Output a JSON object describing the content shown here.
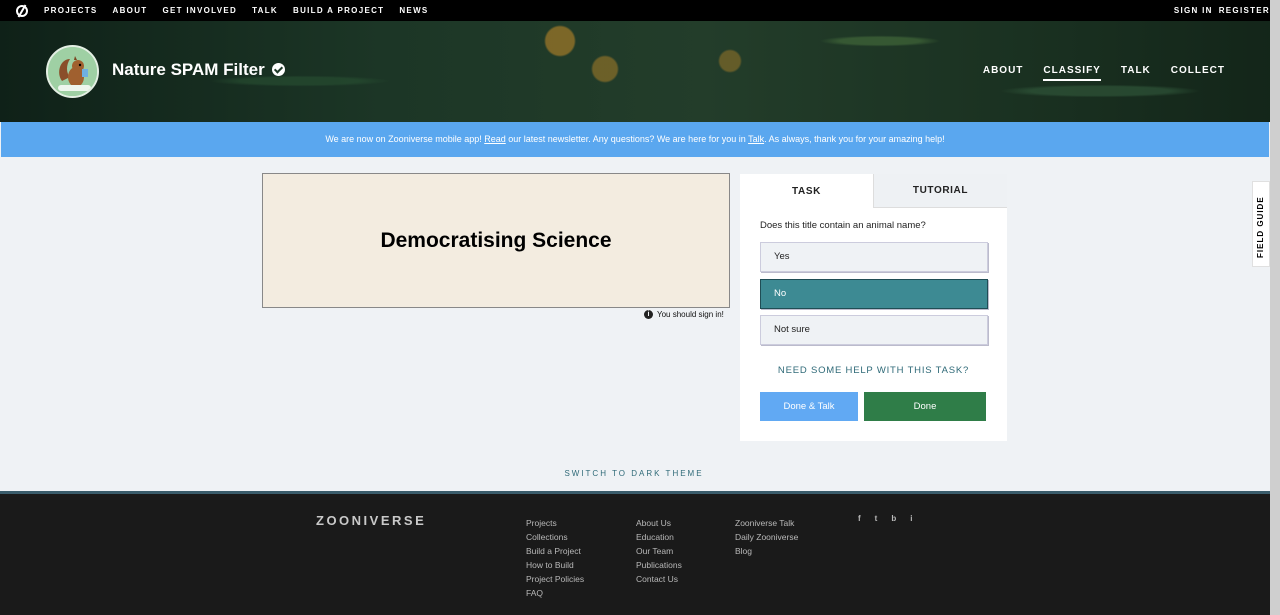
{
  "topbar": {
    "nav": [
      "PROJECTS",
      "ABOUT",
      "GET INVOLVED",
      "TALK",
      "BUILD A PROJECT",
      "NEWS"
    ],
    "sign_in": "SIGN IN",
    "register": "REGISTER"
  },
  "project": {
    "title": "Nature SPAM Filter",
    "nav": [
      "ABOUT",
      "CLASSIFY",
      "TALK",
      "COLLECT"
    ],
    "active_nav": "CLASSIFY"
  },
  "announcement": {
    "part1": "We are now on Zooniverse mobile app! ",
    "read_link": "Read",
    "part2": " our latest newsletter. Any questions? We are here for you in ",
    "talk_link": "Talk",
    "part3": ". As always, thank you for your amazing help!"
  },
  "subject": {
    "text": "Democratising Science",
    "sign_in_note": "You should sign in!"
  },
  "task_panel": {
    "tabs": [
      "TASK",
      "TUTORIAL"
    ],
    "question": "Does this title contain an animal name?",
    "answers": [
      "Yes",
      "No",
      "Not sure"
    ],
    "selected_answer": "No",
    "help_link": "NEED SOME HELP WITH THIS TASK?",
    "done_talk_label": "Done & Talk",
    "done_label": "Done"
  },
  "field_guide_label": "FIELD GUIDE",
  "theme_toggle": "SWITCH TO DARK THEME",
  "footer": {
    "logo": "ZOONIVERSE",
    "col1": [
      "Projects",
      "Collections",
      "Build a Project",
      "How to Build",
      "Project Policies",
      "FAQ"
    ],
    "col2": [
      "About Us",
      "Education",
      "Our Team",
      "Publications",
      "Contact Us"
    ],
    "col3": [
      "Zooniverse Talk",
      "Daily Zooniverse",
      "Blog"
    ],
    "social": [
      "f",
      "t",
      "b",
      "i"
    ]
  },
  "colors": {
    "announcement_bg": "#5aa7ef",
    "selected_answer": "#3d8a93",
    "done_button": "#2f7d48",
    "done_talk_button": "#61a9f3"
  }
}
